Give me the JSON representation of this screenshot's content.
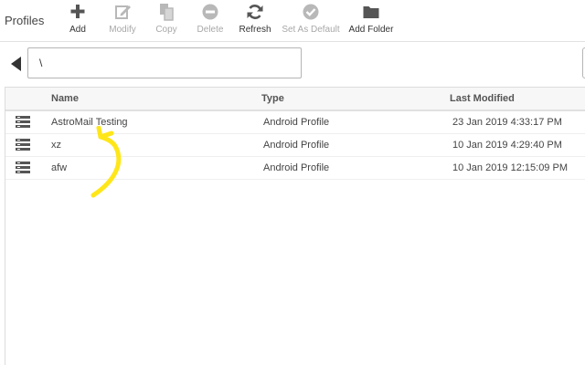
{
  "app": {
    "title": "Profiles"
  },
  "toolbar": {
    "buttons": [
      {
        "label": "Add",
        "icon": "plus-icon",
        "enabled": true
      },
      {
        "label": "Modify",
        "icon": "edit-icon",
        "enabled": false
      },
      {
        "label": "Copy",
        "icon": "copy-icon",
        "enabled": false
      },
      {
        "label": "Delete",
        "icon": "minus-circle-icon",
        "enabled": false
      },
      {
        "label": "Refresh",
        "icon": "refresh-icon",
        "enabled": true
      },
      {
        "label": "Set As Default",
        "icon": "check-circle-icon",
        "enabled": false
      },
      {
        "label": "Add Folder",
        "icon": "folder-icon",
        "enabled": true
      }
    ]
  },
  "path": {
    "value": "\\"
  },
  "table": {
    "columns": {
      "name": "Name",
      "type": "Type",
      "modified": "Last Modified"
    },
    "rows": [
      {
        "name": "AstroMail Testing",
        "type": "Android Profile",
        "modified": "23 Jan 2019 4:33:17 PM"
      },
      {
        "name": "xz",
        "type": "Android Profile",
        "modified": "10 Jan 2019 4:29:40 PM"
      },
      {
        "name": "afw",
        "type": "Android Profile",
        "modified": "10 Jan 2019 12:15:09 PM"
      }
    ]
  },
  "colors": {
    "enabled_icon": "#555555",
    "disabled_icon": "#b8b8b8",
    "annotation": "#ffe619"
  }
}
